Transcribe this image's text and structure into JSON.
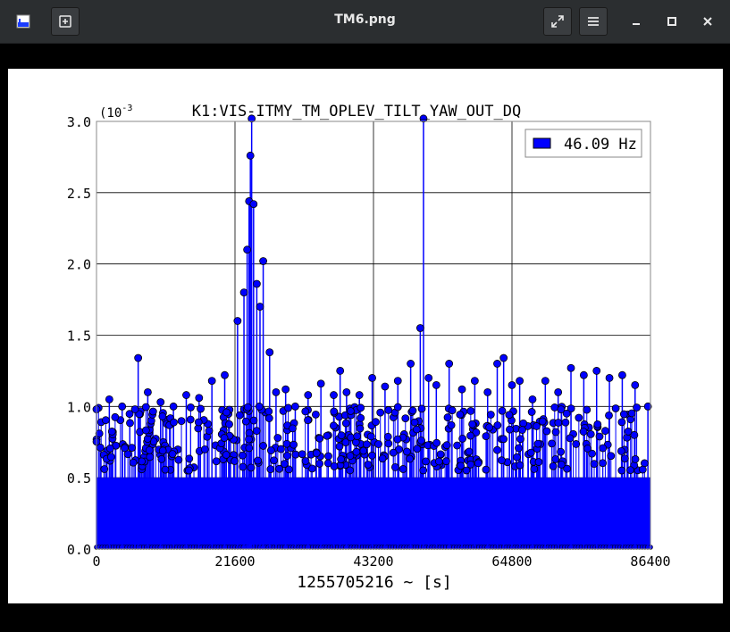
{
  "window": {
    "title": "TM6.png"
  },
  "icons": {
    "app": "image-viewer-icon",
    "new": "new-window-icon",
    "fullscreen": "fullscreen-icon",
    "menu": "hamburger-menu-icon",
    "minimize": "minimize-icon",
    "maximize": "maximize-icon",
    "close": "close-icon"
  },
  "colors": {
    "series": "#0000ff",
    "marker_edge": "#000000",
    "titlebar": "#2b2e30"
  },
  "chart_data": {
    "type": "scatter",
    "style": "stem with filled circle markers",
    "title": "K1:VIS-ITMY_TM_OPLEV_TILT_YAW_OUT_DQ",
    "xlabel": "1255705216 ~ [s]",
    "ylabel": "",
    "y_scale_label": "(10",
    "y_scale_exponent": "-3",
    "xlim": [
      0,
      86400
    ],
    "ylim": [
      0,
      3.0
    ],
    "y_unit_multiplier": 0.001,
    "xticks": [
      "0",
      "21600",
      "43200",
      "64800",
      "86400"
    ],
    "yticks": [
      "0.0",
      "0.5",
      "1.0",
      "1.5",
      "2.0",
      "2.5",
      "3.0"
    ],
    "grid": true,
    "legend": {
      "placement": "top-right",
      "entries": [
        "46.09 Hz"
      ]
    },
    "series": [
      {
        "name": "46.09 Hz",
        "x": [
          0,
          2000,
          4000,
          6000,
          6500,
          8000,
          10000,
          12000,
          14000,
          16000,
          18000,
          20000,
          22000,
          23000,
          23500,
          23800,
          24000,
          24200,
          24500,
          25000,
          25500,
          26000,
          27000,
          28000,
          29500,
          31000,
          33000,
          35000,
          37000,
          38000,
          39000,
          41000,
          43000,
          45000,
          47000,
          49000,
          50500,
          51000,
          51800,
          53000,
          55000,
          57000,
          59000,
          61000,
          62500,
          63500,
          64800,
          66000,
          68000,
          70000,
          72000,
          74000,
          76000,
          78000,
          80000,
          82000,
          84000,
          86000
        ],
        "y": [
          0.98,
          1.05,
          1.0,
          0.98,
          1.34,
          1.1,
          1.03,
          1.0,
          1.08,
          1.06,
          1.18,
          1.22,
          1.6,
          1.8,
          2.1,
          2.44,
          2.76,
          3.02,
          2.42,
          1.86,
          1.7,
          2.02,
          1.38,
          1.1,
          1.12,
          1.0,
          1.08,
          1.16,
          1.08,
          1.25,
          1.1,
          1.08,
          1.2,
          1.14,
          1.18,
          1.3,
          1.55,
          3.02,
          1.2,
          1.15,
          1.3,
          1.12,
          1.18,
          1.1,
          1.3,
          1.34,
          1.15,
          1.18,
          1.05,
          1.18,
          1.1,
          1.27,
          1.22,
          1.25,
          1.2,
          1.22,
          1.15,
          1.0
        ]
      }
    ]
  }
}
